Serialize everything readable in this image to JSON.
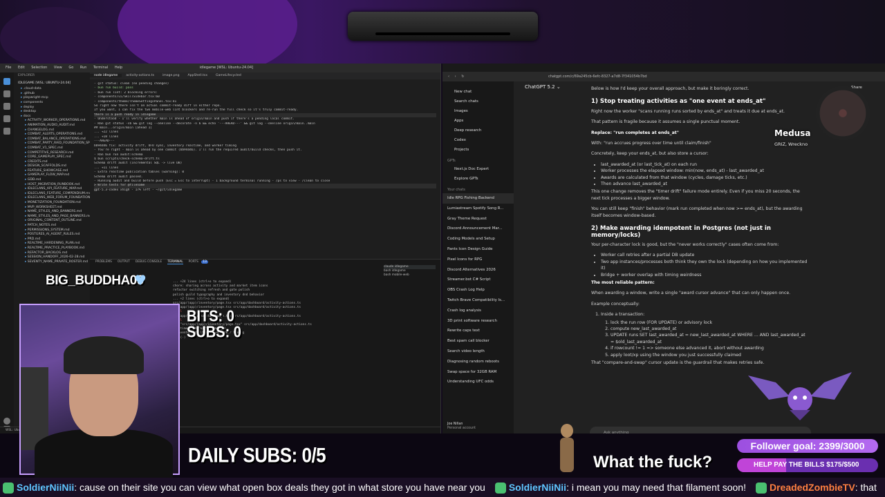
{
  "vscode": {
    "menu": [
      "File",
      "Edit",
      "Selection",
      "View",
      "Go",
      "Run",
      "Terminal",
      "Help"
    ],
    "title": "idlegame [WSL: Ubuntu-24.04]",
    "tabs": [
      "node idlegame",
      "activity-actions.ts",
      "image.png",
      "AppShell.tsx",
      "GameLifecycled"
    ],
    "explorer_header": "EXPLORER",
    "workspace": "IDLEGAME [WSL: UBUNTU-24.04]",
    "folders": [
      ".cloud-data",
      ".github",
      "playwright-mcp",
      "components",
      "deploy",
      "desktop",
      "docs"
    ],
    "files": [
      "ACTIVITY_WORKER_OPERATIONS.md",
      "ANIMATION_AUDIO_AUDIT.md",
      "CHANGELOG.md",
      "COMBAT_ALERTS_OPERATIONS.md",
      "COMBAT_BALANCE_OPERATIONS.md",
      "COMBAT_PARTY_RAID_FOUNDATION_SPEC...",
      "COMBAT_V1_SPEC.md",
      "COMPETITIVE_RESEARCH.md",
      "CORE_GAMEPLAY_SPEC.md",
      "CREDITS.md",
      "DESIGN_SCAFFOLDS.md",
      "FEATURE_SHOWCASE.md",
      "GAMEPLAY_FLOW_MAP.md",
      "GDD.md",
      "HOST_MIGRATION_RUNBOOK.md",
      "IDLECLANS_API_FEATURE_MAP.md",
      "IDLECLANS_FEATURE_COMPENDIUM.md",
      "IDLECLANS_WEB_FORUM_FOUNDATION_SPEC...",
      "MONETIZATION_FOUNDATION.md",
      "MVP_WORKSHEET.md",
      "NAME_STYLES_AND_BANNERS.md",
      "NAME_STYLES_AND_PAGE_BANNERS.md",
      "ORIGINAL_CONTENT_OUTLINE.md",
      "PATCH_NOTES.md",
      "PERMISSIONS_SYSTEM.md",
      "POSTGRES_AI_AGENT_RULES.md",
      "PRD.md",
      "REALTIME_HARDENING_PLAN.md",
      "REALTIME_PRACTICE_PLAYBOOK.md",
      "REFACTOR_BACKLOG.md",
      "SESSION_HANDOFF_2026-02-28.md",
      "SEVENTY_NAME_PRIVATE_ROSTER.md"
    ],
    "editor_lines": [
      "- git status: clean (no pending changes)",
      "- bun run build: pass",
      "- bun run lint: 2 blocking errors:",
      "    - components/ui/SkillSidebar.tsx:60",
      "    - components/theme/ThemeSettingsPanel.tsx:41",
      "",
      "So right now there isn't an actual commit-ready diff in either repo.",
      "If you want, I can fix the two mobile-web lint blockers and re-run the full check so it's truly commit-ready.",
      "",
      "there is a push ready in idlegame",
      "",
      "- Understood - I'll verify whether main is ahead of origin/main and push if there's a pending local commit.",
      "",
      "- Ran git status -sb && git log --oneline --decorate -n 6 && echo '---AHEAD---' && git log --oneline origin/main..main",
      "    ## main...origin/main [ahead 1]",
      "    ... +22 lines",
      "    ... +18 lines",
      "    ---AHEAD---",
      "    bb94d46 fix: activity drift, UFO sync, inventory realtime, and worker timing",
      "",
      "- You're right - main is ahead by one commit (bb94d46). I'll run the required audit/build checks, then push it.",
      "",
      "- Ran bun run audit:schema",
      "    $ bun scripts/check-schema-drift.ts",
      "    Schema drift audit (incremental SQL -> live DB)",
      "    ... +11 lines",
      "    - Extra realtime publication tables (warning): 0",
      "    Schema drift audit passed.",
      "",
      "- Running audit and build before push (Esc = Esc to interrupt) - 1 background terminal running - /ps to view - /clean to close",
      "",
      "> Write tests for @filename",
      "",
      "  gpt-5.3-codex xhigh - 17% left - ~/git/idlegame"
    ],
    "panel_tabs": [
      "PROBLEMS",
      "OUTPUT",
      "DEBUG CONSOLE",
      "TERMINAL",
      "PORTS"
    ],
    "ports_badge": "13",
    "terminals": [
      "claude idlegame",
      "bash idlegame",
      "bash mobile-web"
    ],
    "terminal_lines": [
      "... +24 lines (ctrl+o to expand)",
      "chore: sharing across activity and market item icons",
      "refactor switching refresh and gate polish",
      "polish guild typography and inventory dnd behavior",
      "... +2 lines (ctrl+o to expand)",
      "src/app/(app)/inventory/page.tsx src/app/dashboard/activity-actions.ts",
      "",
      "src/app/(app)/inventory/page.tsx src/app/dashboard/activity-actions.ts",
      "/null",
      "",
      "src/app/(app)/inventory/page.tsx src/app/dashboard/activity-actions.ts",
      "/null",
      "",
      ".md \"src/app/(app)/inventory/page.tsx\" src/app/dashboard/activity-actions.ts",
      "",
      "realtime, and worker timing.)",
      ", inventory realtime, and worker timing",
      "ions(-)"
    ],
    "status": "WSL: Ubuntu-24.04   main*   0 0   Ln 1, Col 1   Spaces: 2   UTF-8   LF   Prettier"
  },
  "browser": {
    "url": "chatgpt.com/c/69a245cb-6efc-8327-a7d8-7f341054b7bd",
    "model": "ChatGPT 5.2",
    "share": "Share",
    "nav": [
      "New chat",
      "Search chats",
      "Images",
      "Apps",
      "Deep research",
      "Codex",
      "Projects"
    ],
    "gpts_label": "GPTs",
    "gpts": [
      "Next.js Doc Expert",
      "Explore GPTs"
    ],
    "chats_label": "Your chats",
    "chats": [
      "Idle RPG Fishing Backend",
      "Lumiastream Spotify Song R...",
      "Gray Theme Request",
      "Discord Announcement Mar...",
      "Coding Models and Setup",
      "Pants Icon Design Guide",
      "Pixel Icons for RPG",
      "Discord Alternatives 2026",
      "Streamer.bot C# Script",
      "OBS Crash Log Help",
      "Twitch Brave Compatibility Is...",
      "Crash log analysis",
      "3D print software research",
      "Rewrite caps text",
      "Best spam call blocker",
      "Search video length",
      "Diagnosing random reboots",
      "Swap space for 32GB RAM",
      "Understanding UFC odds"
    ],
    "user_name": "Joe Nillan",
    "user_sub": "Personal account",
    "content": {
      "intro": "Below is how I'd keep your overall approach, but make it boringly correct.",
      "h1": "1) Stop treating activities as \"one event at ends_at\"",
      "p1": "Right now the worker \"scans running runs sorted by ends_at\" and treats it due at ends_at.",
      "p2": "That pattern is fragile because it assumes a single punctual moment.",
      "replace": "Replace: \"run completes at ends_at\"",
      "with": "With: \"run accrues progress over time until claim/finish\"",
      "concretely": "Concretely, keep your ends_at, but also store a cursor:",
      "bullets1": [
        "last_awarded_at (or last_tick_at) on each run",
        "Worker processes the elapsed window: min(now, ends_at) - last_awarded_at",
        "Awards are calculated from that window (cycles, damage ticks, etc.)",
        "Then advance last_awarded_at"
      ],
      "p3": "This one change removes the \"timer drift\" failure mode entirely. Even if you miss 20 seconds, the next tick processes a bigger window.",
      "p4": "You can still keep \"finish\" behavior (mark run completed when now >= ends_at), but the awarding itself becomes window-based.",
      "h2": "2) Make awarding idempotent in Postgres (not just in memory/locks)",
      "p5": "Your per-character lock is good, but the \"never works correctly\" cases often come from:",
      "bullets2": [
        "Worker call retries after a partial DB update",
        "Two app instances/processes both think they own the lock (depending on how you implemented it)",
        "Bridge + worker overlap with timing weirdness"
      ],
      "reliable": "The most reliable pattern:",
      "p6": "When awarding a window, write a single \"award cursor advance\" that can only happen once.",
      "example": "Example conceptually:",
      "inside": "Inside a transaction:",
      "steps": [
        "lock the run row (FOR UPDATE) or advisory lock",
        "compute new_last_awarded_at",
        "UPDATE runs SET last_awarded_at = new_last_awarded_at WHERE ... AND last_awarded_at = $old_last_awarded_at",
        "if rowcount != 1 => someone else advanced it, abort without awarding",
        "apply loot/xp using the window you just successfully claimed"
      ],
      "tail": "That \"compare-and-swap\" cursor update is the guardrail that makes retries safe."
    },
    "input_placeholder": "Ask anything",
    "disclaimer": "ChatGPT can make mistakes. Check important info."
  },
  "overlay": {
    "song_title": "Medusa",
    "song_artist": "GRIZ, Wreckno",
    "cam_name": "BIG_BUDDHA09",
    "bits": "BITS: 0",
    "subs": "SUBS: 0",
    "daily_subs": "DAILY SUBS: 0/5",
    "alert_text": "What the fuck?",
    "follower_goal": "Follower goal: 2399/3000",
    "bills_goal": "HELP PAY THE BILLS $175/$500",
    "bills_progress": 0.35,
    "accent": "#b46af0",
    "ticker": [
      {
        "user": "SoldierNiiNii",
        "msg": "cause on their site you can view what open box deals they got in what store you have near you"
      },
      {
        "user": "SoldierNiiNii",
        "msg": "i mean you may need that filament soon!"
      },
      {
        "user": "DreadedZombieTV",
        "msg": "that"
      }
    ]
  }
}
